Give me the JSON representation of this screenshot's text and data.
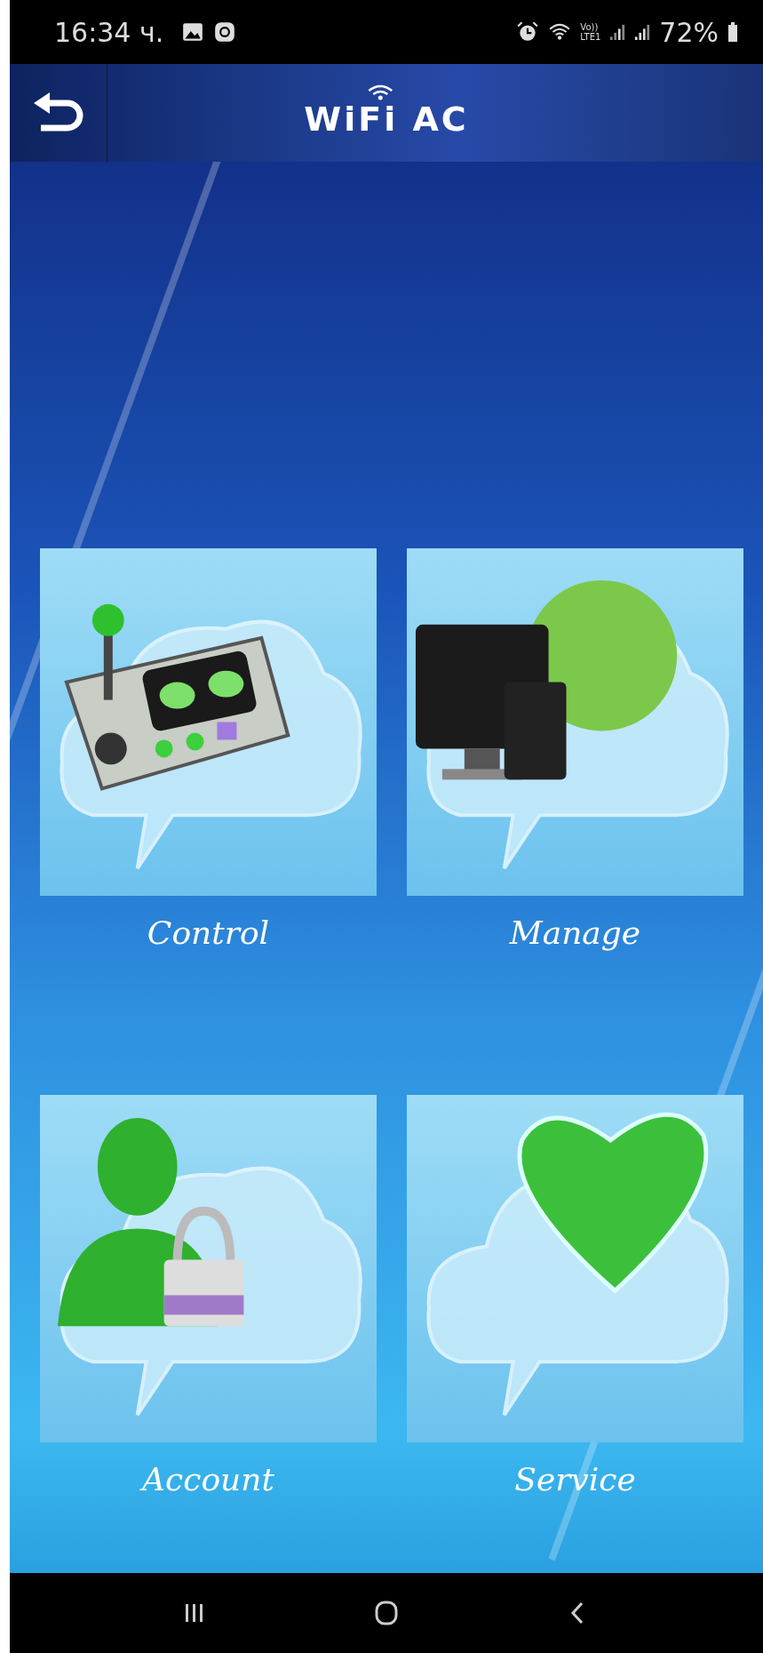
{
  "status_bar": {
    "time": "16:34 ч.",
    "volte_top": "Vo))",
    "volte_bottom": "LTE1",
    "battery": "72%"
  },
  "header": {
    "title": "WiFi AC"
  },
  "tiles": [
    {
      "kind": "control",
      "label": "Control"
    },
    {
      "kind": "manage",
      "label": "Manage"
    },
    {
      "kind": "account",
      "label": "Account"
    },
    {
      "kind": "service",
      "label": "Service"
    }
  ]
}
